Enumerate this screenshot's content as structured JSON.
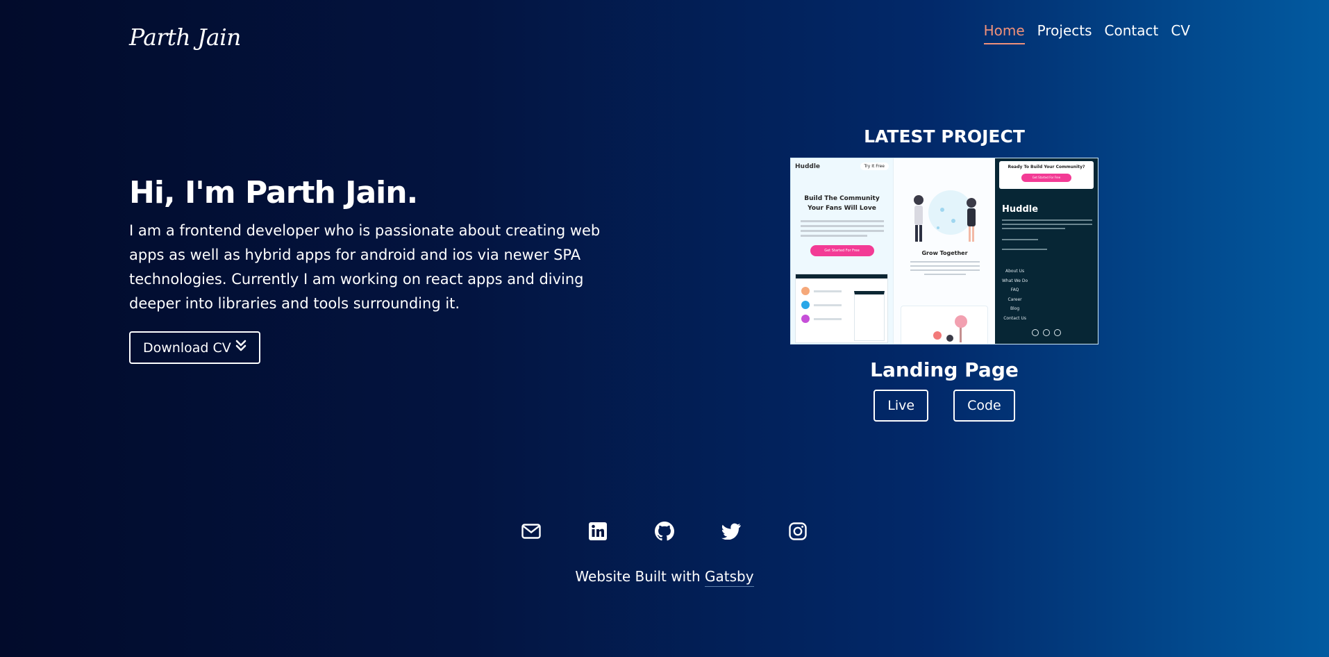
{
  "header": {
    "logo": "Parth Jain",
    "nav": [
      "Home",
      "Projects",
      "Contact",
      "CV"
    ]
  },
  "hero": {
    "title": "Hi, I'm Parth Jain.",
    "intro": "I am a frontend developer who is passionate about creating web apps as well as hybrid apps for android and ios via newer SPA technologies. Currently I am working on react apps and diving deeper into libraries and tools surrounding it.",
    "download_label": "Download CV"
  },
  "project": {
    "heading": "LATEST PROJECT",
    "name": "Landing Page",
    "live_label": "Live",
    "code_label": "Code",
    "preview": {
      "brand": "Huddle",
      "try_label": "Try It Free",
      "headline": "Build The Community Your Fans Will Love",
      "cta": "Get Started For Free",
      "feature": "Grow Together",
      "footer_heading": "Ready To Build Your Community?",
      "footer_links": [
        "About Us",
        "What We Do",
        "FAQ",
        "Career",
        "Blog",
        "Contact Us"
      ]
    }
  },
  "socials": [
    "mail-icon",
    "linkedin-icon",
    "github-icon",
    "twitter-icon",
    "instagram-icon"
  ],
  "footer": {
    "prefix": "Website Built with ",
    "link": "Gatsby"
  },
  "colors": {
    "accent": "#f0917a",
    "preview_pink": "#f33b95",
    "preview_dark": "#072635"
  }
}
